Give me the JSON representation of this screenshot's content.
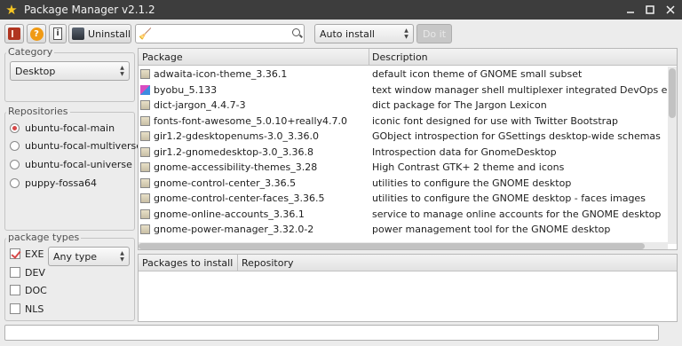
{
  "window": {
    "title": "Package Manager v2.1.2",
    "app_icon": "star-icon",
    "controls": [
      "minimize-icon",
      "maximize-icon",
      "close-icon"
    ]
  },
  "toolbar": {
    "icon_buttons": [
      "exit-icon",
      "help-icon",
      "info-icon"
    ],
    "uninstall_label": "Uninstall",
    "search": {
      "value": "",
      "placeholder": ""
    },
    "mode_select": "Auto install",
    "go_label": "Do it"
  },
  "sidebar": {
    "category_label": "Category",
    "category_value": "Desktop",
    "repositories_label": "Repositories",
    "repositories": [
      {
        "label": "ubuntu-focal-main",
        "selected": true
      },
      {
        "label": "ubuntu-focal-multiverse",
        "selected": false
      },
      {
        "label": "ubuntu-focal-universe",
        "selected": false
      },
      {
        "label": "puppy-fossa64",
        "selected": false
      }
    ],
    "types_label": "package types",
    "types": [
      {
        "label": "EXE",
        "checked": true
      },
      {
        "label": "DEV",
        "checked": false
      },
      {
        "label": "DOC",
        "checked": false
      },
      {
        "label": "NLS",
        "checked": false
      }
    ],
    "type_filter": "Any type"
  },
  "packages": {
    "headers": {
      "package": "Package",
      "description": "Description"
    },
    "rows": [
      {
        "name": "adwaita-icon-theme_3.36.1",
        "desc": "default icon theme of GNOME small subset",
        "icon": "package-icon"
      },
      {
        "name": "byobu_5.133",
        "desc": "text window manager shell multiplexer integrated DevOps environment",
        "icon": "byobu-icon"
      },
      {
        "name": "dict-jargon_4.4.7-3",
        "desc": "dict package for The Jargon Lexicon",
        "icon": "package-icon"
      },
      {
        "name": "fonts-font-awesome_5.0.10+really4.7.0",
        "desc": "iconic font designed for use with Twitter Bootstrap",
        "icon": "package-icon"
      },
      {
        "name": "gir1.2-gdesktopenums-3.0_3.36.0",
        "desc": "GObject introspection for GSettings desktop-wide schemas",
        "icon": "package-icon"
      },
      {
        "name": "gir1.2-gnomedesktop-3.0_3.36.8",
        "desc": "Introspection data for GnomeDesktop",
        "icon": "package-icon"
      },
      {
        "name": "gnome-accessibility-themes_3.28",
        "desc": "High Contrast GTK+ 2 theme and icons",
        "icon": "package-icon"
      },
      {
        "name": "gnome-control-center_3.36.5",
        "desc": "utilities to configure the GNOME desktop",
        "icon": "package-icon"
      },
      {
        "name": "gnome-control-center-faces_3.36.5",
        "desc": "utilities to configure the GNOME desktop - faces images",
        "icon": "package-icon"
      },
      {
        "name": "gnome-online-accounts_3.36.1",
        "desc": "service to manage online accounts for the GNOME desktop",
        "icon": "package-icon"
      },
      {
        "name": "gnome-power-manager_3.32.0-2",
        "desc": "power management tool for the GNOME desktop",
        "icon": "package-icon"
      }
    ]
  },
  "install": {
    "headers": {
      "packages": "Packages to install",
      "repository": "Repository"
    }
  },
  "status": ""
}
